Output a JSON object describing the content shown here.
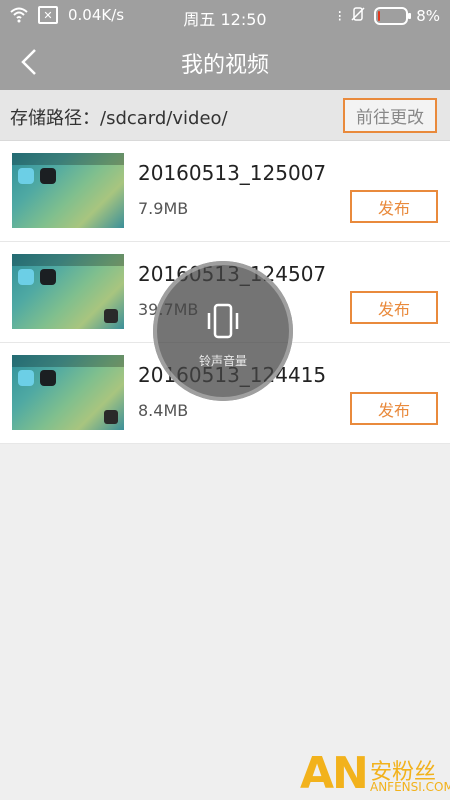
{
  "status_bar": {
    "speed": "0.04K/s",
    "time": "周五 12:50",
    "battery": "8%",
    "battery_level": 0.08
  },
  "header": {
    "title": "我的视频"
  },
  "storage": {
    "path_text": "存储路径：/sdcard/video/",
    "change_button": "前往更改"
  },
  "videos": [
    {
      "name": "20160513_125007",
      "size": "7.9MB",
      "action": "发布"
    },
    {
      "name": "20160513_124507",
      "size": "39.7MB",
      "action": "发布"
    },
    {
      "name": "20160513_124415",
      "size": "8.4MB",
      "action": "发布"
    }
  ],
  "overlay": {
    "label": "铃声音量"
  },
  "watermark": {
    "logo": "AN",
    "cn": "安粉丝",
    "en": "ANFENSI.COM"
  },
  "colors": {
    "header_bg": "#9f9f9f",
    "accent": "#e98a3c",
    "battery_low": "#e3371c"
  }
}
